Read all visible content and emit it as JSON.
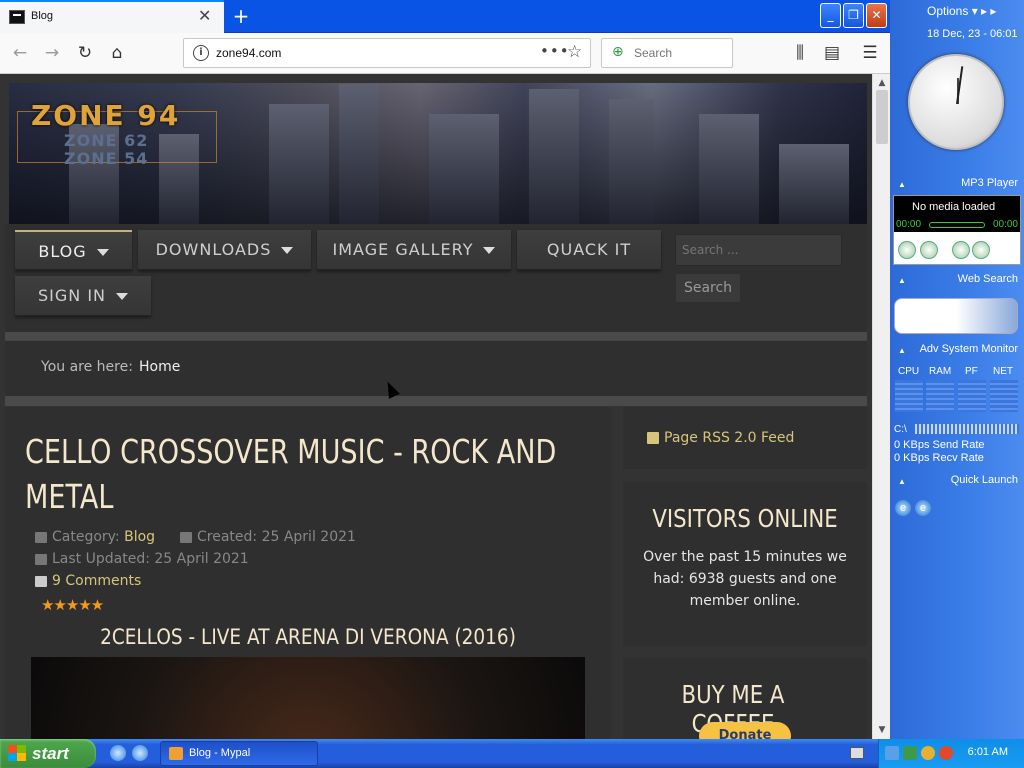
{
  "browser": {
    "tab_title": "Blog",
    "close_glyph": "✕",
    "newtab_glyph": "+",
    "url": "zone94.com",
    "search_placeholder": "Search",
    "window_controls": {
      "minimize": "_",
      "maximize": "❐",
      "close": "✕"
    }
  },
  "site": {
    "logo": "ZONE 94",
    "logo_sub1": "ZONE 62",
    "logo_sub2": "ZONE 54",
    "menu": {
      "blog": "BLOG",
      "downloads": "DOWNLOADS",
      "gallery": "IMAGE GALLERY",
      "quack": "QUACK IT",
      "signin": "SIGN IN"
    },
    "search_placeholder": "Search ...",
    "search_button": "Search",
    "breadcrumb_label": "You are here:",
    "breadcrumb_home": "Home"
  },
  "article": {
    "title": "CELLO CROSSOVER MUSIC - ROCK AND METAL",
    "category_label": "Category:",
    "category_value": "Blog",
    "created": "Created: 25 April 2021",
    "updated": "Last Updated: 25 April 2021",
    "comments": "9 Comments",
    "stars": "★★★★★",
    "rating": 5,
    "video_title": "2CELLOS - LIVE AT ARENA DI VERONA (2016)"
  },
  "sidebar": {
    "rss": "Page RSS 2.0 Feed",
    "visitors_title": "VISITORS ONLINE",
    "visitors_text": "Over the past 15 minutes we had: 6938 guests and one member online.",
    "coffee_title": "BUY ME A COFFEE",
    "donate": "Donate"
  },
  "gadgets": {
    "options": "Options",
    "date": "18 Dec, 23 - 06:01",
    "mp3_title": "MP3 Player",
    "mp3_status": "No media loaded",
    "mp3_time_start": "00:00",
    "mp3_time_end": "00:00",
    "websearch_title": "Web Search",
    "sysmon_title": "Adv System Monitor",
    "sysmon_cols": [
      "CPU",
      "RAM",
      "PF",
      "NET"
    ],
    "disk_label": "C:\\",
    "send_rate": "0 KBps Send Rate",
    "recv_rate": "0 KBps Recv Rate",
    "quicklaunch_title": "Quick Launch"
  },
  "taskbar": {
    "start": "start",
    "task_blog": "Blog - Mypal",
    "time": "6:01 AM"
  },
  "colors": {
    "accent_gold": "#d7c57c",
    "title_cream": "#f3e7cc",
    "xp_blue": "#245edb"
  }
}
